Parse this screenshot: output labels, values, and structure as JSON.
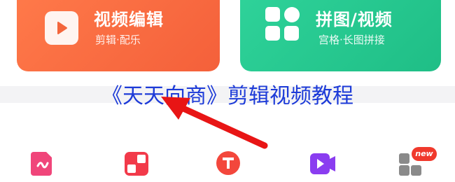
{
  "cards": {
    "edit": {
      "title": "视频编辑",
      "subtitle": "剪辑·配乐"
    },
    "grid": {
      "title": "拼图/视频",
      "subtitle": "宫格·长图拼接"
    }
  },
  "caption": "《天天向商》剪辑视频教程",
  "bottom_bar": {
    "badge": "new",
    "icons": [
      "doc-icon",
      "collage-icon",
      "text-icon",
      "video-icon",
      "more-icon"
    ]
  },
  "colors": {
    "edit_card": "#f4603a",
    "grid_card": "#1fbe86",
    "caption": "#1d3bd8",
    "arrow": "#e81515"
  }
}
